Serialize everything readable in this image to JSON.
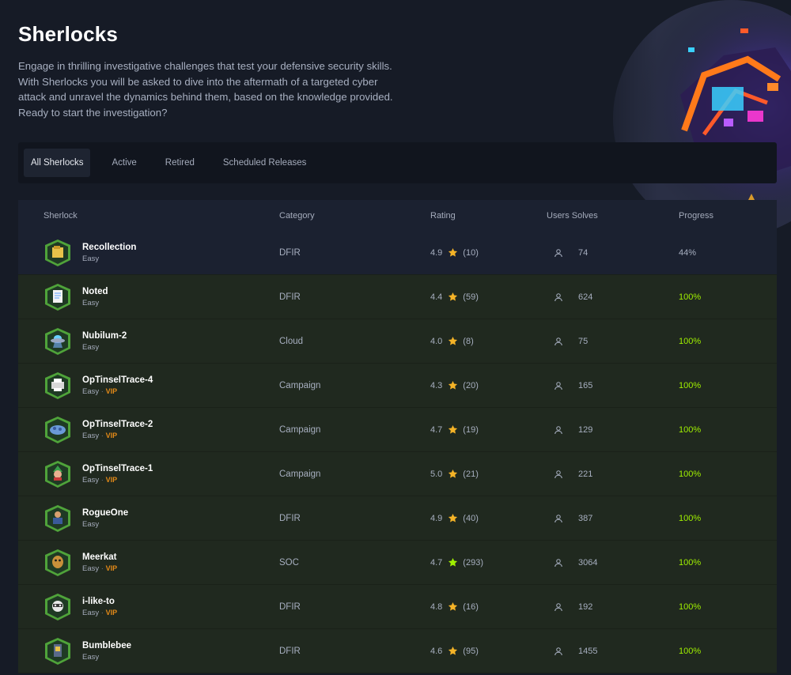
{
  "page": {
    "title": "Sherlocks",
    "intro": "Engage in thrilling investigative challenges that test your defensive security skills. With Sherlocks you will be asked to dive into the aftermath of a targeted cyber attack and unravel the dynamics behind them, based on the knowledge provided. Ready to start the investigation?"
  },
  "tabs": [
    {
      "label": "All Sherlocks",
      "active": true
    },
    {
      "label": "Active",
      "active": false
    },
    {
      "label": "Retired",
      "active": false
    },
    {
      "label": "Scheduled Releases",
      "active": false
    }
  ],
  "table": {
    "headers": {
      "sherlock": "Sherlock",
      "category": "Category",
      "rating": "Rating",
      "users_solves": "Users Solves",
      "progress": "Progress"
    },
    "rows": [
      {
        "name": "Recollection",
        "difficulty": "Easy",
        "vip": "",
        "category": "DFIR",
        "rating": "4.9",
        "votes": "(10)",
        "star": "gold",
        "solves": "74",
        "progress": "44%",
        "progress_value": 0.44,
        "complete": false,
        "icon": "badge-folder-icon"
      },
      {
        "name": "Noted",
        "difficulty": "Easy",
        "vip": "",
        "category": "DFIR",
        "rating": "4.4",
        "votes": "(59)",
        "star": "gold",
        "solves": "624",
        "progress": "100%",
        "progress_value": 1.0,
        "complete": true,
        "icon": "badge-notepad-icon"
      },
      {
        "name": "Nubilum-2",
        "difficulty": "Easy",
        "vip": "",
        "category": "Cloud",
        "rating": "4.0",
        "votes": "(8)",
        "star": "gold",
        "solves": "75",
        "progress": "100%",
        "progress_value": 1.0,
        "complete": true,
        "icon": "badge-ufo-icon"
      },
      {
        "name": "OpTinselTrace-4",
        "difficulty": "Easy",
        "vip": "VIP",
        "category": "Campaign",
        "rating": "4.3",
        "votes": "(20)",
        "star": "gold",
        "solves": "165",
        "progress": "100%",
        "progress_value": 1.0,
        "complete": true,
        "icon": "badge-printer-icon"
      },
      {
        "name": "OpTinselTrace-2",
        "difficulty": "Easy",
        "vip": "VIP",
        "category": "Campaign",
        "rating": "4.7",
        "votes": "(19)",
        "star": "gold",
        "solves": "129",
        "progress": "100%",
        "progress_value": 1.0,
        "complete": true,
        "icon": "badge-cloud-icon"
      },
      {
        "name": "OpTinselTrace-1",
        "difficulty": "Easy",
        "vip": "VIP",
        "category": "Campaign",
        "rating": "5.0",
        "votes": "(21)",
        "star": "gold",
        "solves": "221",
        "progress": "100%",
        "progress_value": 1.0,
        "complete": true,
        "icon": "badge-elf-icon"
      },
      {
        "name": "RogueOne",
        "difficulty": "Easy",
        "vip": "",
        "category": "DFIR",
        "rating": "4.9",
        "votes": "(40)",
        "star": "gold",
        "solves": "387",
        "progress": "100%",
        "progress_value": 1.0,
        "complete": true,
        "icon": "badge-figure-icon"
      },
      {
        "name": "Meerkat",
        "difficulty": "Easy",
        "vip": "VIP",
        "category": "SOC",
        "rating": "4.7",
        "votes": "(293)",
        "star": "green",
        "solves": "3064",
        "progress": "100%",
        "progress_value": 1.0,
        "complete": true,
        "icon": "badge-meerkat-icon"
      },
      {
        "name": "i-like-to",
        "difficulty": "Easy",
        "vip": "VIP",
        "category": "DFIR",
        "rating": "4.8",
        "votes": "(16)",
        "star": "gold",
        "solves": "192",
        "progress": "100%",
        "progress_value": 1.0,
        "complete": true,
        "icon": "badge-raccoon-icon"
      },
      {
        "name": "Bumblebee",
        "difficulty": "Easy",
        "vip": "",
        "category": "DFIR",
        "rating": "4.6",
        "votes": "(95)",
        "star": "gold",
        "solves": "1455",
        "progress": "100%",
        "progress_value": 1.0,
        "complete": true,
        "icon": "badge-bee-icon"
      }
    ]
  },
  "colors": {
    "background": "#161b26",
    "panel": "#11151e",
    "row_partial": "#1b2130",
    "row_complete": "#20291f",
    "accent_green": "#9fef00",
    "star_gold": "#f4b327",
    "star_green": "#9fef00",
    "vip_orange": "#e38a18"
  }
}
